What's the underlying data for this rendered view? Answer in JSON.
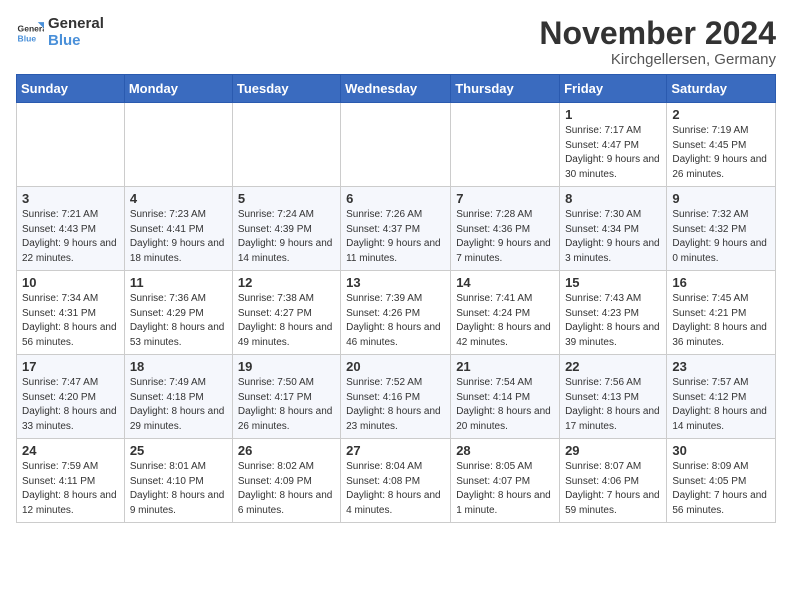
{
  "logo": {
    "line1": "General",
    "line2": "Blue"
  },
  "title": "November 2024",
  "location": "Kirchgellersen, Germany",
  "days_of_week": [
    "Sunday",
    "Monday",
    "Tuesday",
    "Wednesday",
    "Thursday",
    "Friday",
    "Saturday"
  ],
  "weeks": [
    [
      {
        "day": "",
        "info": ""
      },
      {
        "day": "",
        "info": ""
      },
      {
        "day": "",
        "info": ""
      },
      {
        "day": "",
        "info": ""
      },
      {
        "day": "",
        "info": ""
      },
      {
        "day": "1",
        "info": "Sunrise: 7:17 AM\nSunset: 4:47 PM\nDaylight: 9 hours and 30 minutes."
      },
      {
        "day": "2",
        "info": "Sunrise: 7:19 AM\nSunset: 4:45 PM\nDaylight: 9 hours and 26 minutes."
      }
    ],
    [
      {
        "day": "3",
        "info": "Sunrise: 7:21 AM\nSunset: 4:43 PM\nDaylight: 9 hours and 22 minutes."
      },
      {
        "day": "4",
        "info": "Sunrise: 7:23 AM\nSunset: 4:41 PM\nDaylight: 9 hours and 18 minutes."
      },
      {
        "day": "5",
        "info": "Sunrise: 7:24 AM\nSunset: 4:39 PM\nDaylight: 9 hours and 14 minutes."
      },
      {
        "day": "6",
        "info": "Sunrise: 7:26 AM\nSunset: 4:37 PM\nDaylight: 9 hours and 11 minutes."
      },
      {
        "day": "7",
        "info": "Sunrise: 7:28 AM\nSunset: 4:36 PM\nDaylight: 9 hours and 7 minutes."
      },
      {
        "day": "8",
        "info": "Sunrise: 7:30 AM\nSunset: 4:34 PM\nDaylight: 9 hours and 3 minutes."
      },
      {
        "day": "9",
        "info": "Sunrise: 7:32 AM\nSunset: 4:32 PM\nDaylight: 9 hours and 0 minutes."
      }
    ],
    [
      {
        "day": "10",
        "info": "Sunrise: 7:34 AM\nSunset: 4:31 PM\nDaylight: 8 hours and 56 minutes."
      },
      {
        "day": "11",
        "info": "Sunrise: 7:36 AM\nSunset: 4:29 PM\nDaylight: 8 hours and 53 minutes."
      },
      {
        "day": "12",
        "info": "Sunrise: 7:38 AM\nSunset: 4:27 PM\nDaylight: 8 hours and 49 minutes."
      },
      {
        "day": "13",
        "info": "Sunrise: 7:39 AM\nSunset: 4:26 PM\nDaylight: 8 hours and 46 minutes."
      },
      {
        "day": "14",
        "info": "Sunrise: 7:41 AM\nSunset: 4:24 PM\nDaylight: 8 hours and 42 minutes."
      },
      {
        "day": "15",
        "info": "Sunrise: 7:43 AM\nSunset: 4:23 PM\nDaylight: 8 hours and 39 minutes."
      },
      {
        "day": "16",
        "info": "Sunrise: 7:45 AM\nSunset: 4:21 PM\nDaylight: 8 hours and 36 minutes."
      }
    ],
    [
      {
        "day": "17",
        "info": "Sunrise: 7:47 AM\nSunset: 4:20 PM\nDaylight: 8 hours and 33 minutes."
      },
      {
        "day": "18",
        "info": "Sunrise: 7:49 AM\nSunset: 4:18 PM\nDaylight: 8 hours and 29 minutes."
      },
      {
        "day": "19",
        "info": "Sunrise: 7:50 AM\nSunset: 4:17 PM\nDaylight: 8 hours and 26 minutes."
      },
      {
        "day": "20",
        "info": "Sunrise: 7:52 AM\nSunset: 4:16 PM\nDaylight: 8 hours and 23 minutes."
      },
      {
        "day": "21",
        "info": "Sunrise: 7:54 AM\nSunset: 4:14 PM\nDaylight: 8 hours and 20 minutes."
      },
      {
        "day": "22",
        "info": "Sunrise: 7:56 AM\nSunset: 4:13 PM\nDaylight: 8 hours and 17 minutes."
      },
      {
        "day": "23",
        "info": "Sunrise: 7:57 AM\nSunset: 4:12 PM\nDaylight: 8 hours and 14 minutes."
      }
    ],
    [
      {
        "day": "24",
        "info": "Sunrise: 7:59 AM\nSunset: 4:11 PM\nDaylight: 8 hours and 12 minutes."
      },
      {
        "day": "25",
        "info": "Sunrise: 8:01 AM\nSunset: 4:10 PM\nDaylight: 8 hours and 9 minutes."
      },
      {
        "day": "26",
        "info": "Sunrise: 8:02 AM\nSunset: 4:09 PM\nDaylight: 8 hours and 6 minutes."
      },
      {
        "day": "27",
        "info": "Sunrise: 8:04 AM\nSunset: 4:08 PM\nDaylight: 8 hours and 4 minutes."
      },
      {
        "day": "28",
        "info": "Sunrise: 8:05 AM\nSunset: 4:07 PM\nDaylight: 8 hours and 1 minute."
      },
      {
        "day": "29",
        "info": "Sunrise: 8:07 AM\nSunset: 4:06 PM\nDaylight: 7 hours and 59 minutes."
      },
      {
        "day": "30",
        "info": "Sunrise: 8:09 AM\nSunset: 4:05 PM\nDaylight: 7 hours and 56 minutes."
      }
    ]
  ]
}
